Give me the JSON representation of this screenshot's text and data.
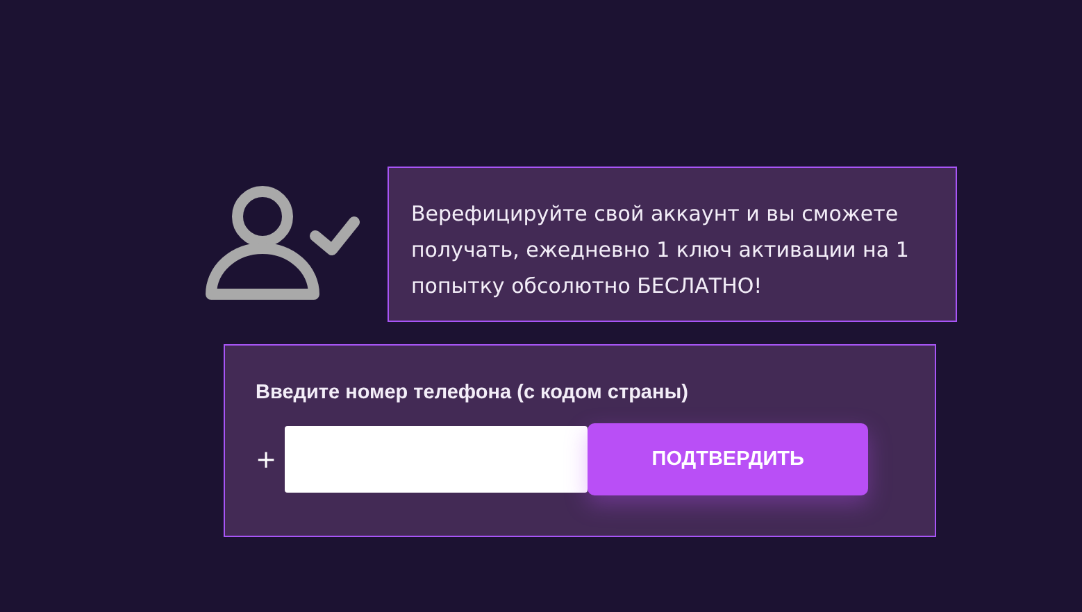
{
  "info": {
    "text": "Верефицируйте свой аккаунт и вы сможете получать, ежедневно 1 ключ активации на 1 попытку обсолютно БЕСЛАТНО!"
  },
  "phone_form": {
    "label": "Введите номер телефона (с кодом страны)",
    "prefix": "+",
    "button": "ПОДТВЕРДИТЬ"
  }
}
